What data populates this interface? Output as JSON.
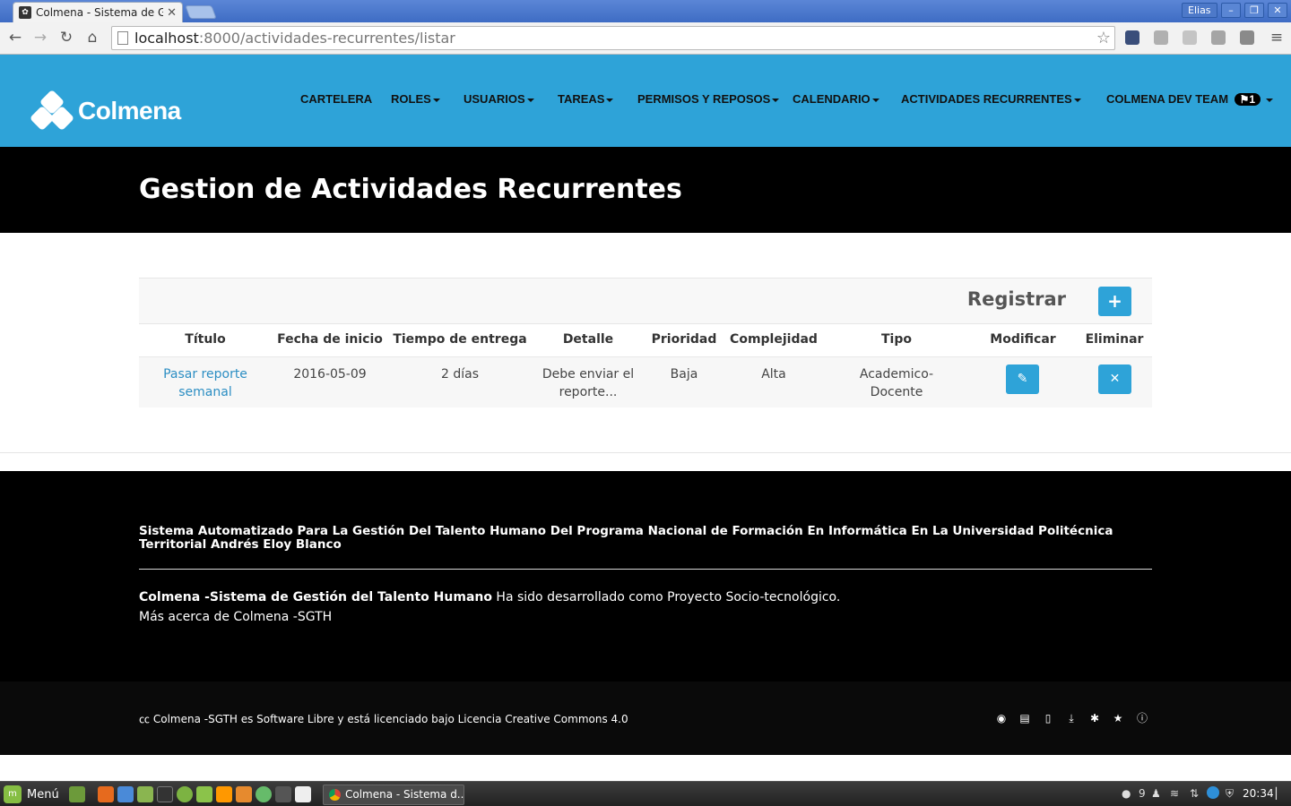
{
  "browser": {
    "tab_title": "Colmena - Sistema de Ge",
    "url_host": "localhost",
    "url_rest": ":8000/actividades-recurrentes/listar",
    "window_user": "Elias"
  },
  "navbar": {
    "brand": "Colmena",
    "items": [
      {
        "label": "CARTELERA",
        "dropdown": false
      },
      {
        "label": "ROLES",
        "dropdown": true
      },
      {
        "label": "USUARIOS",
        "dropdown": true
      },
      {
        "label": "TAREAS",
        "dropdown": true
      },
      {
        "label": "PERMISOS Y REPOSOS",
        "dropdown": true
      },
      {
        "label": "CALENDARIO",
        "dropdown": true
      },
      {
        "label": "ACTIVIDADES RECURRENTES",
        "dropdown": true
      }
    ],
    "user_menu": {
      "label": "COLMENA DEV TEAM",
      "badge": "1"
    },
    "colors": {
      "navbar": "#2ea3d8",
      "band": "#000000"
    }
  },
  "page": {
    "title": "Gestion de Actividades Recurrentes"
  },
  "panel": {
    "register_label": "Registrar",
    "register_button": "+",
    "columns": [
      "Título",
      "Fecha de inicio",
      "Tiempo de entrega",
      "Detalle",
      "Prioridad",
      "Complejidad",
      "Tipo",
      "Modificar",
      "Eliminar"
    ],
    "rows": [
      {
        "titulo_1": "Pasar reporte",
        "titulo_2": "semanal",
        "fecha": "2016-05-09",
        "tiempo": "2 días",
        "detalle_1": "Debe enviar el",
        "detalle_2": "reporte...",
        "prioridad": "Baja",
        "complejidad": "Alta",
        "tipo": "Academico-Docente",
        "edit_icon": "pencil-icon",
        "delete_icon": "close-icon"
      }
    ]
  },
  "footer": {
    "title": "Sistema Automatizado Para La Gestión Del Talento Humano Del Programa Nacional de Formación En Informática En La Universidad Politécnica Territorial Andrés Eloy Blanco",
    "app_name": "Colmena -Sistema de Gestión del Talento Humano",
    "developed_text": " Ha sido desarrollado como Proyecto Socio-tecnológico.",
    "more_link": "Más acerca de Colmena -SGTH",
    "license": "Colmena -SGTH es Software Libre y está licenciado bajo Licencia Creative Commons 4.0",
    "license_icon": "creative-commons-icon",
    "icons": [
      "github-icon",
      "document-icon",
      "pdf-icon",
      "download-icon",
      "bug-icon",
      "star-icon",
      "info-icon"
    ]
  },
  "taskbar": {
    "menu_label": "Menú",
    "window_label": "Colmena - Sistema d...",
    "notifications": "9",
    "clock": "20:34"
  }
}
